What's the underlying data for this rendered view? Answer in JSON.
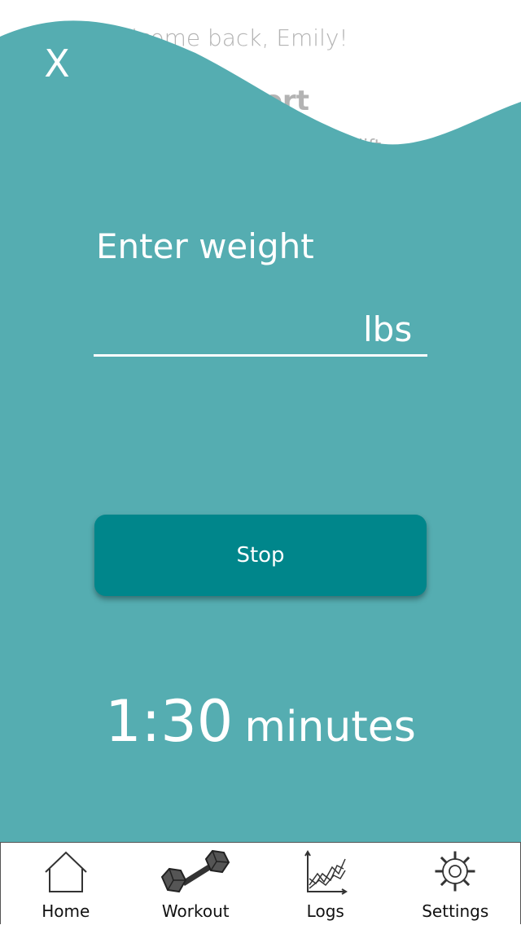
{
  "background": {
    "greeting": "Welcome back, Emily!",
    "report_title": "Report",
    "partial_text": "lift"
  },
  "modal": {
    "close_label": "X",
    "weight_label": "Enter weight",
    "weight_value": "",
    "weight_unit": "lbs",
    "stop_label": "Stop",
    "timer_value": "1:30",
    "timer_unit": "minutes"
  },
  "nav": {
    "items": [
      {
        "label": "Home",
        "icon": "home-icon"
      },
      {
        "label": "Workout",
        "icon": "dumbbell-icon"
      },
      {
        "label": "Logs",
        "icon": "chart-icon"
      },
      {
        "label": "Settings",
        "icon": "gear-icon"
      }
    ]
  },
  "colors": {
    "overlay": "#55adb1",
    "stop_button": "#00868b",
    "text": "#ffffff"
  }
}
